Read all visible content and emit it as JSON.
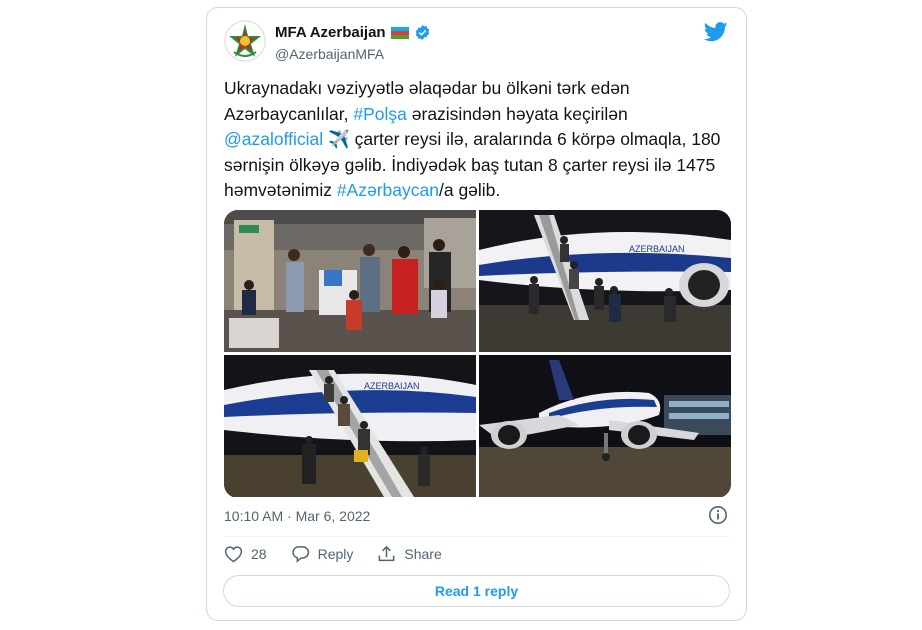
{
  "account": {
    "display_name": "MFA Azerbaijan",
    "handle": "@AzerbaijanMFA",
    "flag_colors": [
      "#00b5e2",
      "#ef3340",
      "#509e2f"
    ],
    "verified_icon": "verified-badge-icon"
  },
  "tweet": {
    "segments": [
      {
        "text": "Ukraynadakı vəziyyətlə əlaqədar bu ölkəni tərk edən Azərbaycanlılar, ",
        "link": false
      },
      {
        "text": "#Polşa",
        "link": true
      },
      {
        "text": " ərazisindən həyata keçirilən ",
        "link": false
      },
      {
        "text": "@azalofficial",
        "link": true
      },
      {
        "text": " ✈️ çarter reysi ilə, aralarında 6 körpə olmaqla, 180 sərnişin ölkəyə gəlib. İndiyədək baş tutan 8 çarter reysi ilə 1475 həmvətənimiz ",
        "link": false
      },
      {
        "text": "#Azərbaycan",
        "link": true
      },
      {
        "text": "/a gəlib.",
        "link": false
      }
    ],
    "timestamp": "10:10 AM · Mar 6, 2022"
  },
  "photos": [
    {
      "name": "airport-terminal-passengers-photo"
    },
    {
      "name": "aircraft-stairs-night-photo"
    },
    {
      "name": "boarding-stairs-passengers-photo"
    },
    {
      "name": "aircraft-front-view-photo"
    }
  ],
  "actions": {
    "like_count": "28",
    "reply_label": "Reply",
    "share_label": "Share"
  },
  "read_reply_label": "Read 1 reply",
  "colors": {
    "link": "#1d9bf0",
    "muted": "#536471",
    "border": "#cfd9de"
  }
}
